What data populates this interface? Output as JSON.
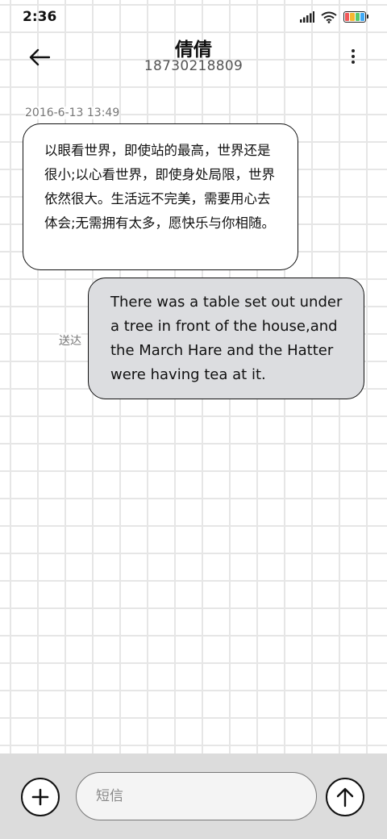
{
  "status_bar": {
    "time": "2:36",
    "icons": [
      "signal-icon",
      "wifi-icon",
      "battery-icon"
    ],
    "battery_colors": [
      "#f25a5a",
      "#f7b731",
      "#58c96b",
      "#3fa9f5"
    ]
  },
  "header": {
    "back_icon": "arrow-left-icon",
    "contact_name": "倩倩",
    "contact_number": "18730218809",
    "more_icon": "more-vertical-icon"
  },
  "conversation": {
    "timestamp": "2016-6-13 13:49",
    "messages": [
      {
        "direction": "incoming",
        "text": "以眼看世界，即使站的最高，世界还是很小;以心看世界，即使身处局限，世界依然很大。生活远不完美，需要用心去体会;无需拥有太多，愿快乐与你相随。"
      },
      {
        "direction": "outgoing",
        "text": "There was a table set out under a tree in front of the house,and the March Hare and the Hatter were having tea at it.",
        "status": "送达"
      }
    ]
  },
  "composer": {
    "add_icon": "plus-icon",
    "placeholder": "短信",
    "value": "",
    "send_icon": "arrow-up-icon"
  },
  "colors": {
    "outgoing_bubble": "#dcdde0",
    "incoming_bubble": "#ffffff",
    "composer_bar": "#dcdcdc"
  }
}
